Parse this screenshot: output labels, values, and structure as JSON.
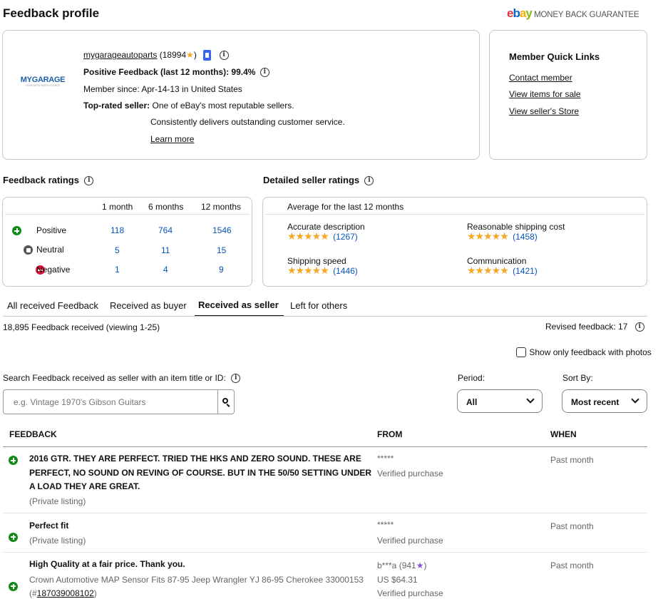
{
  "page_title": "Feedback profile",
  "guarantee": {
    "brand": "ebay",
    "text": "MONEY BACK GUARANTEE"
  },
  "seller": {
    "logo_text": "MYGARAGE",
    "logo_sub": "YOUR AUTO PARTS SOURCE",
    "username": "mygarageautoparts",
    "score": "(18994",
    "score_close": ")",
    "positive_label": "Positive Feedback (last 12 months):",
    "positive_value": "99.4%",
    "member_since": "Member since: Apr-14-13 in United States",
    "top_rated_label": "Top-rated seller:",
    "top_rated_text1": "One of eBay's most reputable sellers.",
    "top_rated_text2": "Consistently delivers outstanding customer service.",
    "learn_more": "Learn more"
  },
  "quick_links": {
    "title": "Member Quick Links",
    "links": [
      "Contact member",
      "View items for sale",
      "View seller's Store"
    ]
  },
  "feedback_ratings": {
    "title": "Feedback ratings",
    "columns": [
      "1 month",
      "6 months",
      "12 months"
    ],
    "rows": [
      {
        "label": "Positive",
        "values": [
          "118",
          "764",
          "1546"
        ]
      },
      {
        "label": "Neutral",
        "values": [
          "5",
          "11",
          "15"
        ]
      },
      {
        "label": "Negative",
        "values": [
          "1",
          "4",
          "9"
        ]
      }
    ]
  },
  "detailed_ratings": {
    "title": "Detailed seller ratings",
    "subtitle": "Average for the last 12 months",
    "items": [
      {
        "label": "Accurate description",
        "count": "(1267)",
        "stars": 5
      },
      {
        "label": "Reasonable shipping cost",
        "count": "(1458)",
        "stars": 5
      },
      {
        "label": "Shipping speed",
        "count": "(1446)",
        "stars": 5
      },
      {
        "label": "Communication",
        "count": "(1421)",
        "stars": 5
      }
    ]
  },
  "tabs": [
    "All received Feedback",
    "Received as buyer",
    "Received as seller",
    "Left for others"
  ],
  "active_tab": "Received as seller",
  "summary": "18,895 Feedback received (viewing 1-25)",
  "revised": "Revised feedback: 17",
  "photos_checkbox": "Show only feedback with photos",
  "search": {
    "label": "Search Feedback received as seller with an item title or ID:",
    "placeholder": "e.g. Vintage 1970's Gibson Guitars"
  },
  "period": {
    "label": "Period:",
    "value": "All"
  },
  "sort": {
    "label": "Sort By:",
    "value": "Most recent"
  },
  "table": {
    "headers": [
      "FEEDBACK",
      "FROM",
      "WHEN"
    ],
    "rows": [
      {
        "text": "2016 GTR. THEY ARE PERFECT. TRIED THE HKS AND ZERO SOUND. THESE ARE PERFECT, NO SOUND ON REVING OF COURSE. BUT IN THE 50/50 SETTING UNDER A LOAD THEY ARE GREAT.",
        "item": "(Private listing)",
        "from": "*****",
        "from2": "Verified purchase",
        "when": "Past month"
      },
      {
        "text": "Perfect fit",
        "item": "(Private listing)",
        "from": "*****",
        "from2": "Verified purchase",
        "when": "Past month"
      },
      {
        "text": "High Quality at a fair price. Thank you.",
        "item": "Crown Automotive MAP Sensor Fits 87-95 Jeep Wrangler YJ 86-95 Cherokee 33000153",
        "item_id_prefix": "(#",
        "item_id": "187039008102",
        "item_id_suffix": ")",
        "from": "b***a",
        "from_score": "(941",
        "from_score_close": ")",
        "price": "US $64.31",
        "from2": "Verified purchase",
        "when": "Past month"
      }
    ]
  },
  "colors": {
    "positive": "#118a18",
    "negative": "#e0103a",
    "neutral": "#555555",
    "link_blue": "#0654ba",
    "star": "#f5a623"
  }
}
